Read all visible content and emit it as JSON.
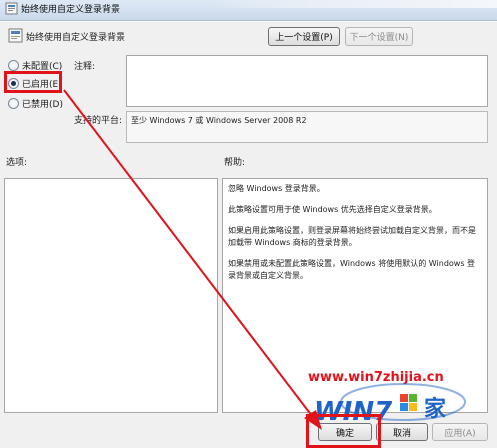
{
  "window": {
    "title": "始终使用自定义登录背景"
  },
  "nav": {
    "prev_setting": "上一个设置(P)",
    "next_setting": "下一个设置(N)"
  },
  "state_options": [
    {
      "label": "未配置(C)",
      "checked": false
    },
    {
      "label": "已启用(E)",
      "checked": true
    },
    {
      "label": "已禁用(D)",
      "checked": false
    }
  ],
  "labels": {
    "comment": "注释:",
    "supported_on": "支持的平台:",
    "options": "选项:",
    "help": "帮助:"
  },
  "supported_on_value": "至少 Windows 7 或 Windows Server 2008 R2",
  "help_text": [
    "忽略 Windows 登录背景。",
    "此策略设置可用于使 Windows 优先选择自定义登录背景。",
    "如果启用此策略设置，则登录屏幕将始终尝试加载自定义背景，而不是加载带 Windows 商标的登录背景。",
    "如果禁用或未配置此策略设置，Windows 将使用默认的 Windows 登录背景或自定义背景。"
  ],
  "footer": {
    "ok": "确定",
    "cancel": "取消",
    "apply": "应用(A)"
  },
  "watermark": {
    "url": "www.win7zhijia.cn",
    "logo_text": "WIN7",
    "logo_suffix": "家"
  },
  "colors": {
    "annotation_red": "#e0131a",
    "watermark_blue": "#1f63c8"
  }
}
